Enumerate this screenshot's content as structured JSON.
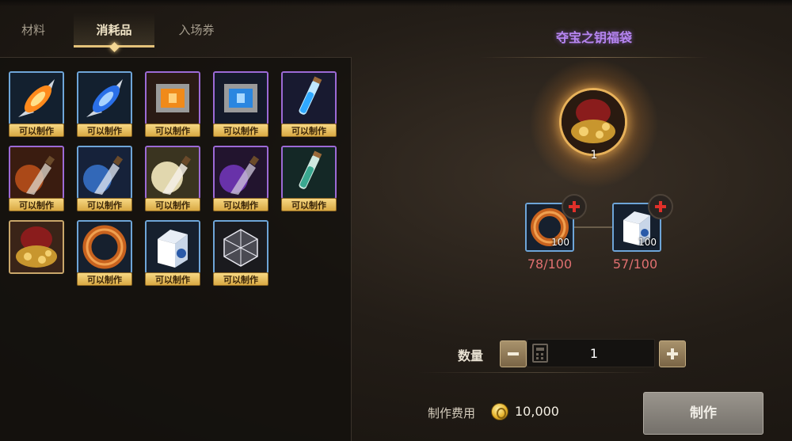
{
  "tabs": [
    "材料",
    "消耗品",
    "入场券"
  ],
  "selected_tab": "消耗品",
  "inventory": {
    "badge_label": "可以制作",
    "slots": [
      {
        "icon": "orange-crystal-icon",
        "rarity": "rare",
        "craftable": true
      },
      {
        "icon": "blue-crystal-icon",
        "rarity": "rare",
        "craftable": true
      },
      {
        "icon": "orange-box-icon",
        "rarity": "epic",
        "craftable": true
      },
      {
        "icon": "blue-box-icon",
        "rarity": "epic",
        "craftable": true
      },
      {
        "icon": "blue-vial-icon",
        "rarity": "epic",
        "craftable": true
      },
      {
        "icon": "fire-potion-icon",
        "rarity": "epic",
        "craftable": true
      },
      {
        "icon": "blue-potion-icon",
        "rarity": "rare",
        "craftable": true
      },
      {
        "icon": "light-potion-icon",
        "rarity": "epic",
        "craftable": true
      },
      {
        "icon": "purple-potion-icon",
        "rarity": "epic",
        "craftable": true
      },
      {
        "icon": "green-vial-icon",
        "rarity": "epic",
        "craftable": true
      },
      {
        "icon": "treasure-bag-icon",
        "rarity": "legendary",
        "craftable": false
      },
      {
        "icon": "pretzel-icon",
        "rarity": "rare",
        "craftable": true
      },
      {
        "icon": "milk-carton-icon",
        "rarity": "rare",
        "craftable": true
      },
      {
        "icon": "crystal-cube-icon",
        "rarity": "rare",
        "craftable": true
      }
    ]
  },
  "recipe": {
    "title": "夺宝之钥福袋",
    "target": {
      "icon": "treasure-bag-icon",
      "count": "1"
    },
    "materials": [
      {
        "icon": "pretzel-icon",
        "required": "100",
        "progress": "78/100"
      },
      {
        "icon": "milk-carton-icon",
        "required": "100",
        "progress": "57/100"
      }
    ]
  },
  "quantity": {
    "label": "数量",
    "value": "1"
  },
  "fee": {
    "label": "制作费用",
    "value": "10,000",
    "icon": "gold-coin-icon"
  },
  "craft_button": "制作",
  "colors": {
    "badge": "#f0c35a",
    "rare_border": "#6ea5d8",
    "epic_border": "#9c6ad6",
    "title": "#b685f0",
    "progress_red": "#e07070"
  }
}
